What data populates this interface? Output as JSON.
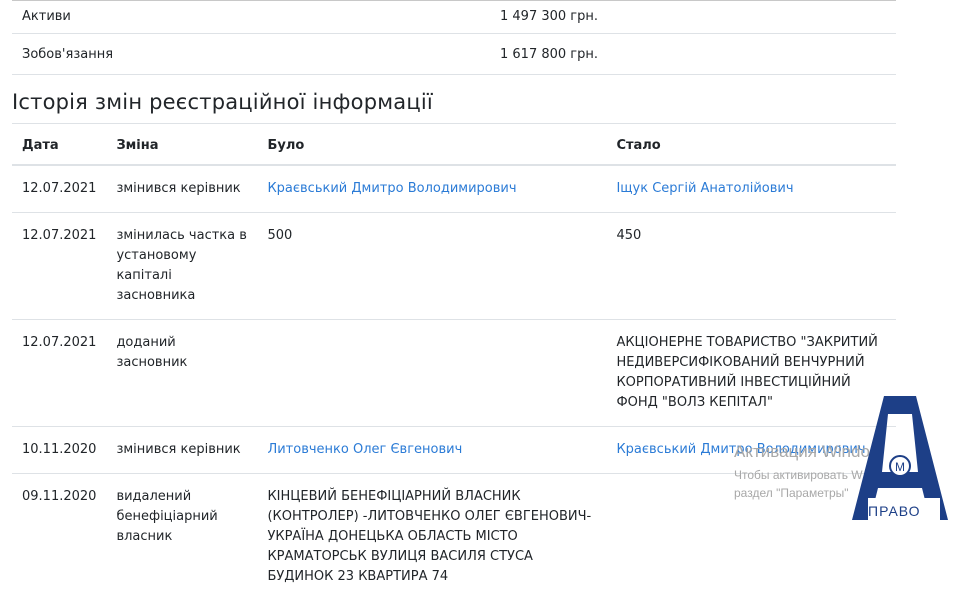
{
  "finances": [
    {
      "label": "Активи",
      "value": "1 497 300 грн."
    },
    {
      "label": "Зобов'язання",
      "value": "1 617 800 грн."
    }
  ],
  "history": {
    "title": "Історія змін реєстраційної інформації",
    "headers": {
      "date": "Дата",
      "change": "Зміна",
      "was": "Було",
      "became": "Стало"
    },
    "rows": [
      {
        "date": "12.07.2021",
        "change": "змінився керівник",
        "was": "Краєвський Дмитро Володимирович",
        "became": "Іщук Сергій Анатолійович"
      },
      {
        "date": "12.07.2021",
        "change": "змінилась частка в установому капіталі засновника",
        "was": "500",
        "became": "450"
      },
      {
        "date": "12.07.2021",
        "change": "доданий засновник",
        "was": "",
        "became": "АКЦІОНЕРНЕ ТОВАРИСТВО \"ЗАКРИТИЙ НЕДИВЕРСИФІКОВАНИЙ ВЕНЧУРНИЙ КОРПОРАТИВНИЙ ІНВЕСТИЦІЙНИЙ ФОНД \"ВОЛЗ КЕПІТАЛ\""
      },
      {
        "date": "10.11.2020",
        "change": "змінився керівник",
        "was": "Литовченко Олег Євгенович",
        "became": "Краєвський Дмитро Володимирович"
      },
      {
        "date": "09.11.2020",
        "change": "видалений бенефіціарний власник",
        "was": "КІНЦЕВИЙ БЕНЕФІЦІАРНИЙ ВЛАСНИК (КОНТРОЛЕР) -ЛИТОВЧЕНКО ОЛЕГ ЄВГЕНОВИЧ- УКРАЇНА ДОНЕЦЬКА ОБЛАСТЬ МІСТО КРАМАТОРСЬК ВУЛИЦЯ ВАСИЛЯ СТУСА БУДИНОК 23 КВАРТИРА 74",
        "became": ""
      }
    ]
  },
  "watermark": {
    "line1": "Активация Windo",
    "line2": "Чтобы активировать W",
    "line3": "раздел \"Параметры\""
  },
  "logo": {
    "text": "ПРАВО",
    "mark": "М",
    "color": "#1d3f87"
  },
  "colors": {
    "link": "#2b7bd6",
    "border": "#dee2e6",
    "text": "#212529"
  }
}
